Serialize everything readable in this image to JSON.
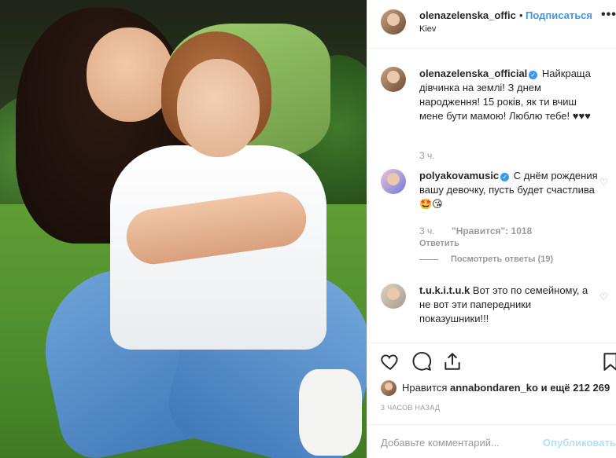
{
  "post": {
    "username_header": "olenazelenska_offic",
    "follow_label": "Подписаться",
    "location": "Kiev",
    "more_icon": "more-dots-icon"
  },
  "comments": [
    {
      "username": "olenazelenska_official",
      "verified": true,
      "text": "Найкраща дівчинка на землі! З днем народження! 15 років, як ти вчиш мене бути мамою! Люблю тебе! ♥♥♥",
      "time": "3 ч."
    },
    {
      "username": "polyakovamusic",
      "verified": true,
      "text": "С днём рождения вашу девочку, пусть будет счастлива 🤩😘",
      "time": "3 ч.",
      "likes_label": "\"Нравится\": 1018",
      "reply_label": "Ответить",
      "view_replies_label": "Посмотреть ответы (19)"
    },
    {
      "username": "t.u.k.i.t.u.k",
      "verified": false,
      "text": "Вот это по семейному, а не вот эти папередники показушники!!!"
    }
  ],
  "likes": {
    "prefix": "Нравится",
    "user": "annabondaren_ko",
    "suffix": "и ещё 212 269"
  },
  "timestamp": "3 ЧАСОВ НАЗАД",
  "add_comment": {
    "placeholder": "Добавьте комментарий...",
    "publish_label": "Опубликовать"
  },
  "colors": {
    "link_blue": "#3897f0",
    "publish_disabled": "#b2dffc",
    "muted": "#999999",
    "text": "#262626"
  }
}
